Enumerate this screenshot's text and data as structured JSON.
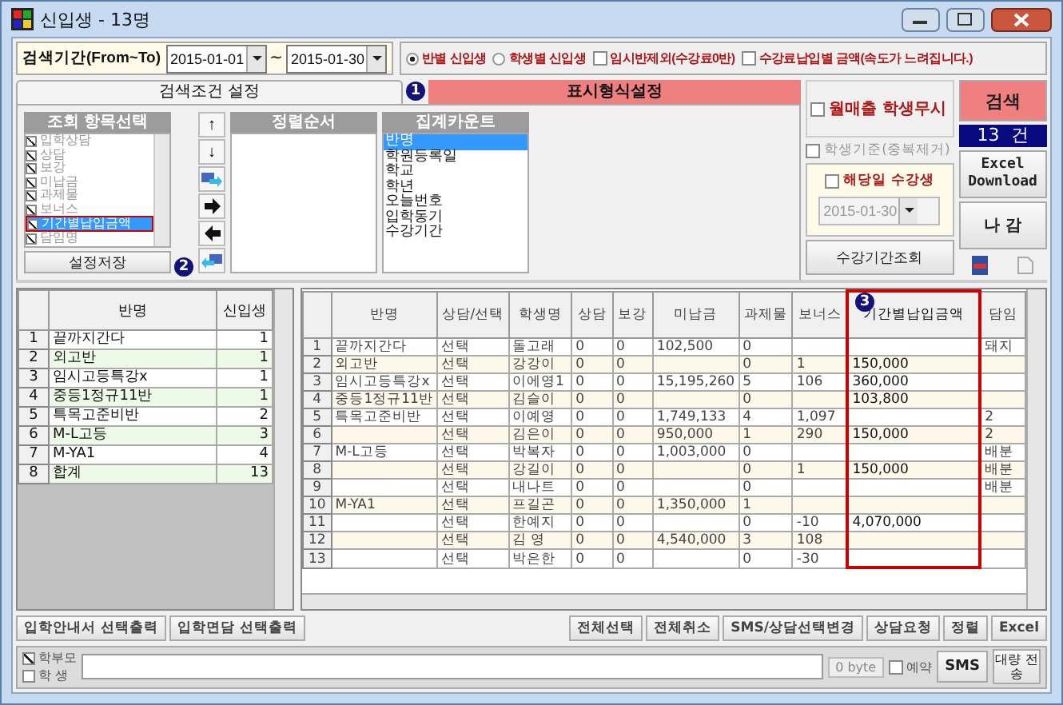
{
  "window": {
    "title": "신입생 - 13명"
  },
  "search_period": {
    "label": "검색기간(From~To)",
    "from": "2015-01-01",
    "separator": "~",
    "to": "2015-01-30"
  },
  "options": [
    {
      "kind": "radio",
      "label": "반별 신입생",
      "checked": true
    },
    {
      "kind": "radio",
      "label": "학생별 신입생",
      "checked": false
    },
    {
      "kind": "checkbox",
      "label": "임시반제외(수강료0반)",
      "checked": false
    },
    {
      "kind": "checkbox",
      "label": "수강료납입별 금액(속도가 느려집니다.)",
      "checked": false
    }
  ],
  "settings_tab": {
    "label": "검색조건 설정"
  },
  "display_format": {
    "badge": "1",
    "title": "표시형식설정"
  },
  "field_list": {
    "title": "조회 항목선택",
    "badge": "2",
    "items": [
      {
        "label": "입학상담",
        "checked": true,
        "selected": false
      },
      {
        "label": "상담",
        "checked": true,
        "selected": false
      },
      {
        "label": "보강",
        "checked": true,
        "selected": false
      },
      {
        "label": "미납금",
        "checked": true,
        "selected": false
      },
      {
        "label": "과제물",
        "checked": true,
        "selected": false
      },
      {
        "label": "보너스",
        "checked": true,
        "selected": false
      },
      {
        "label": "기간별납입금액",
        "checked": true,
        "selected": true
      },
      {
        "label": "담임명",
        "checked": true,
        "selected": false
      }
    ]
  },
  "move_buttons": [
    "↑",
    "↓"
  ],
  "save_button": "설정저장",
  "sort_order": {
    "title": "정렬순서"
  },
  "group_count": {
    "title": "집계카운트",
    "items": [
      {
        "label": "반명",
        "selected": true
      },
      {
        "label": "학원등록일",
        "selected": false
      },
      {
        "label": "학교",
        "selected": false
      },
      {
        "label": "학년",
        "selected": false
      },
      {
        "label": "오늘번호",
        "selected": false
      },
      {
        "label": "입학동기",
        "selected": false
      },
      {
        "label": "수강기간",
        "selected": false
      }
    ]
  },
  "right_options": [
    {
      "label": "월매출 학생무시",
      "checked": false,
      "disabled": false
    },
    {
      "label": "학생기준(중복제거)",
      "checked": false,
      "disabled": true
    }
  ],
  "date_filter": {
    "label": "해당일 수강생",
    "checked": false,
    "date": "2015-01-30",
    "disabled": true
  },
  "period_button": "수강기간조회",
  "search_button": "검색",
  "count": "13  건",
  "excel_button": "Excel Download",
  "exit_button": "나 감",
  "class_table": {
    "columns": [
      "반명",
      "신입생"
    ],
    "rows": [
      {
        "no": "1",
        "name": "끝까지간다",
        "count": "1"
      },
      {
        "no": "2",
        "name": "외고반",
        "count": "1"
      },
      {
        "no": "3",
        "name": "임시고등특강x",
        "count": "1"
      },
      {
        "no": "4",
        "name": "중등1정규11반",
        "count": "1"
      },
      {
        "no": "5",
        "name": "특목고준비반",
        "count": "2"
      },
      {
        "no": "6",
        "name": "M-L고등",
        "count": "3"
      },
      {
        "no": "7",
        "name": "M-YA1",
        "count": "4"
      },
      {
        "no": "8",
        "name": "합계",
        "count": "13"
      }
    ]
  },
  "main_table": {
    "badge": "3",
    "columns": [
      {
        "label": "반명",
        "highlighted": false
      },
      {
        "label": "상담/선택",
        "highlighted": false
      },
      {
        "label": "학생명",
        "highlighted": false
      },
      {
        "label": "상담",
        "highlighted": false
      },
      {
        "label": "보강",
        "highlighted": false
      },
      {
        "label": "미납금",
        "highlighted": false
      },
      {
        "label": "과제물",
        "highlighted": false
      },
      {
        "label": "보너스",
        "highlighted": false
      },
      {
        "label": "기간별납입금액",
        "highlighted": true
      },
      {
        "label": "담임",
        "highlighted": false
      }
    ],
    "rows": [
      {
        "no": "1",
        "cells": [
          "끝까지간다",
          "선택",
          "돌고래",
          "0",
          "0",
          "102,500",
          "0",
          "",
          "",
          "돼지"
        ]
      },
      {
        "no": "2",
        "cells": [
          "외고반",
          "선택",
          "강강이",
          "0",
          "0",
          "",
          "0",
          "1",
          "150,000",
          ""
        ]
      },
      {
        "no": "3",
        "cells": [
          "임시고등특강x",
          "선택",
          "이에영1",
          "0",
          "0",
          "15,195,260",
          "5",
          "106",
          "360,000",
          ""
        ]
      },
      {
        "no": "4",
        "cells": [
          "중등1정규11반",
          "선택",
          "김슬이",
          "0",
          "0",
          "",
          "0",
          "",
          "103,800",
          ""
        ]
      },
      {
        "no": "5",
        "cells": [
          "특목고준비반",
          "선택",
          "이예영",
          "0",
          "0",
          "1,749,133",
          "4",
          "1,097",
          "",
          "2"
        ]
      },
      {
        "no": "6",
        "cells": [
          "",
          "선택",
          "김은이",
          "0",
          "0",
          "950,000",
          "1",
          "290",
          "150,000",
          "2"
        ]
      },
      {
        "no": "7",
        "cells": [
          "M-L고등",
          "선택",
          "박복자",
          "0",
          "0",
          "1,003,000",
          "0",
          "",
          "",
          "배분"
        ]
      },
      {
        "no": "8",
        "cells": [
          "",
          "선택",
          "강길이",
          "0",
          "0",
          "",
          "0",
          "1",
          "150,000",
          "배분"
        ]
      },
      {
        "no": "9",
        "cells": [
          "",
          "선택",
          "내나트",
          "0",
          "0",
          "",
          "0",
          "",
          "",
          "배분"
        ]
      },
      {
        "no": "10",
        "cells": [
          "M-YA1",
          "선택",
          "프길곤",
          "0",
          "0",
          "1,350,000",
          "1",
          "",
          "",
          ""
        ]
      },
      {
        "no": "11",
        "cells": [
          "",
          "선택",
          "한예지",
          "0",
          "0",
          "",
          "0",
          "-10",
          "4,070,000",
          ""
        ]
      },
      {
        "no": "12",
        "cells": [
          "",
          "선택",
          "김 영",
          "0",
          "0",
          "4,540,000",
          "3",
          "108",
          "",
          ""
        ]
      },
      {
        "no": "13",
        "cells": [
          "",
          "선택",
          "박은한",
          "0",
          "0",
          "",
          "0",
          "-30",
          "",
          ""
        ]
      }
    ]
  },
  "print_buttons": [
    "입학안내서 선택출력",
    "입학면담 선택출력"
  ],
  "action_buttons": [
    "전체선택",
    "전체취소",
    "SMS/상담선택변경",
    "상담요청",
    "정렬",
    "Excel"
  ],
  "sms": {
    "recipients": [
      {
        "label": "학부모",
        "checked": true
      },
      {
        "label": "학 생",
        "checked": false
      }
    ],
    "bytes": "0 byte",
    "reserve": {
      "label": "예약",
      "checked": false
    },
    "send_button": "SMS",
    "bulk_button": "대량 전송"
  }
}
